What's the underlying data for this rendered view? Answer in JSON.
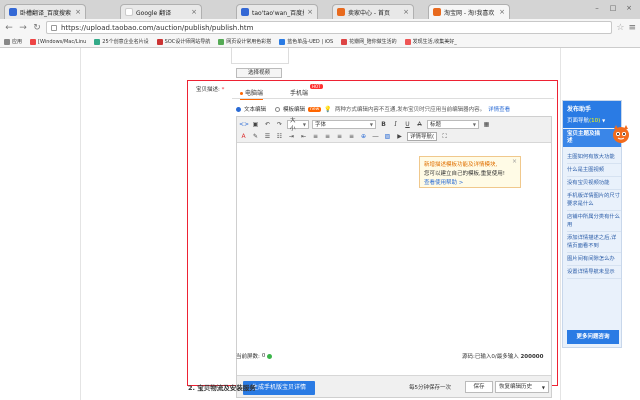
{
  "browser": {
    "tabs": [
      {
        "label": "卧槽翻译_百度搜索",
        "icon": "baidu-paw-icon",
        "active": false
      },
      {
        "label": "Google 翻译",
        "icon": "google-icon",
        "active": false
      },
      {
        "label": "tao'tao'wan_百度搜索",
        "icon": "baidu-paw-icon",
        "active": false
      },
      {
        "label": "卖家中心 - 首页",
        "icon": "taobao-icon",
        "active": false
      },
      {
        "label": "淘宝网 - 淘!我喜欢",
        "icon": "taobao-icon",
        "active": true
      }
    ],
    "url": "https://upload.taobao.com/auction/publish/publish.htm",
    "bookmarks": [
      {
        "label": "应用",
        "icon": "apps-grid-icon"
      },
      {
        "label": "[Windows/Mac/Linu",
        "icon": "bookmark-icon"
      },
      {
        "label": "25个创意企业名片设",
        "icon": "bookmark-icon"
      },
      {
        "label": "SOC设计师网站导航",
        "icon": "bookmark-icon"
      },
      {
        "label": "网页设计常用色彩搭",
        "icon": "bookmark-icon"
      },
      {
        "label": "蓝色单品-UED | iOS",
        "icon": "bookmark-icon"
      },
      {
        "label": "花瓣网_陪你做生活的",
        "icon": "bookmark-icon"
      },
      {
        "label": "发现生活,收集美好_",
        "icon": "bookmark-icon"
      }
    ]
  },
  "page": {
    "choose_video": "选择视频",
    "desc_label": "宝贝描述:",
    "desc_required": "*",
    "tabs": {
      "pc": "电脑端",
      "mobile": "手机端",
      "mobile_badge": "HOT"
    },
    "mode": {
      "text_edit": "文本编辑",
      "template_edit": "模板编辑",
      "new_badge": "new",
      "note": "两种方式编辑内容不互通,发布宝贝时只应用当前编辑器内容。",
      "help_link": "详情查看"
    },
    "editor": {
      "font_size": "大小",
      "font_family": "字体",
      "heading": "标题",
      "template_btn": "详情导航(",
      "tip_line1": "新增描述模板功能及详情模块,",
      "tip_line2": "您可以建立自己的模板,重复使用!",
      "tip_link": "查看使用帮助 >",
      "generate_btn": "生成手机版宝贝详情",
      "autosave": "每5分钟保存一次",
      "save_btn": "保存",
      "restore_btn": "恢复编辑历史"
    },
    "footer": {
      "img_count_label": "当前屏数:",
      "img_count": "0",
      "source_info": "源码:已输入0/最多输入",
      "source_max": "200000"
    },
    "section2_title": "2. 宝贝物流及安装服务"
  },
  "helper": {
    "title": "发布助手",
    "page_helper": "页面导航",
    "page_count": "(10)",
    "section_title": "宝贝主题及描述",
    "items": [
      "主图如何有放大功能",
      "什么是主图视频",
      "没有宝贝视频功能",
      "手机版详情图片的尺寸要求是什么",
      "店铺中所属分类有什么用",
      "添加详情描述之后,详情页面看不到",
      "图片间有间隙怎么办",
      "设置详情导航未显示"
    ],
    "more_btn": "更多问题咨询"
  },
  "colors": {
    "accent_blue": "#2a7be4",
    "alert_red": "#ee2233",
    "accent_orange": "#ff6600"
  }
}
